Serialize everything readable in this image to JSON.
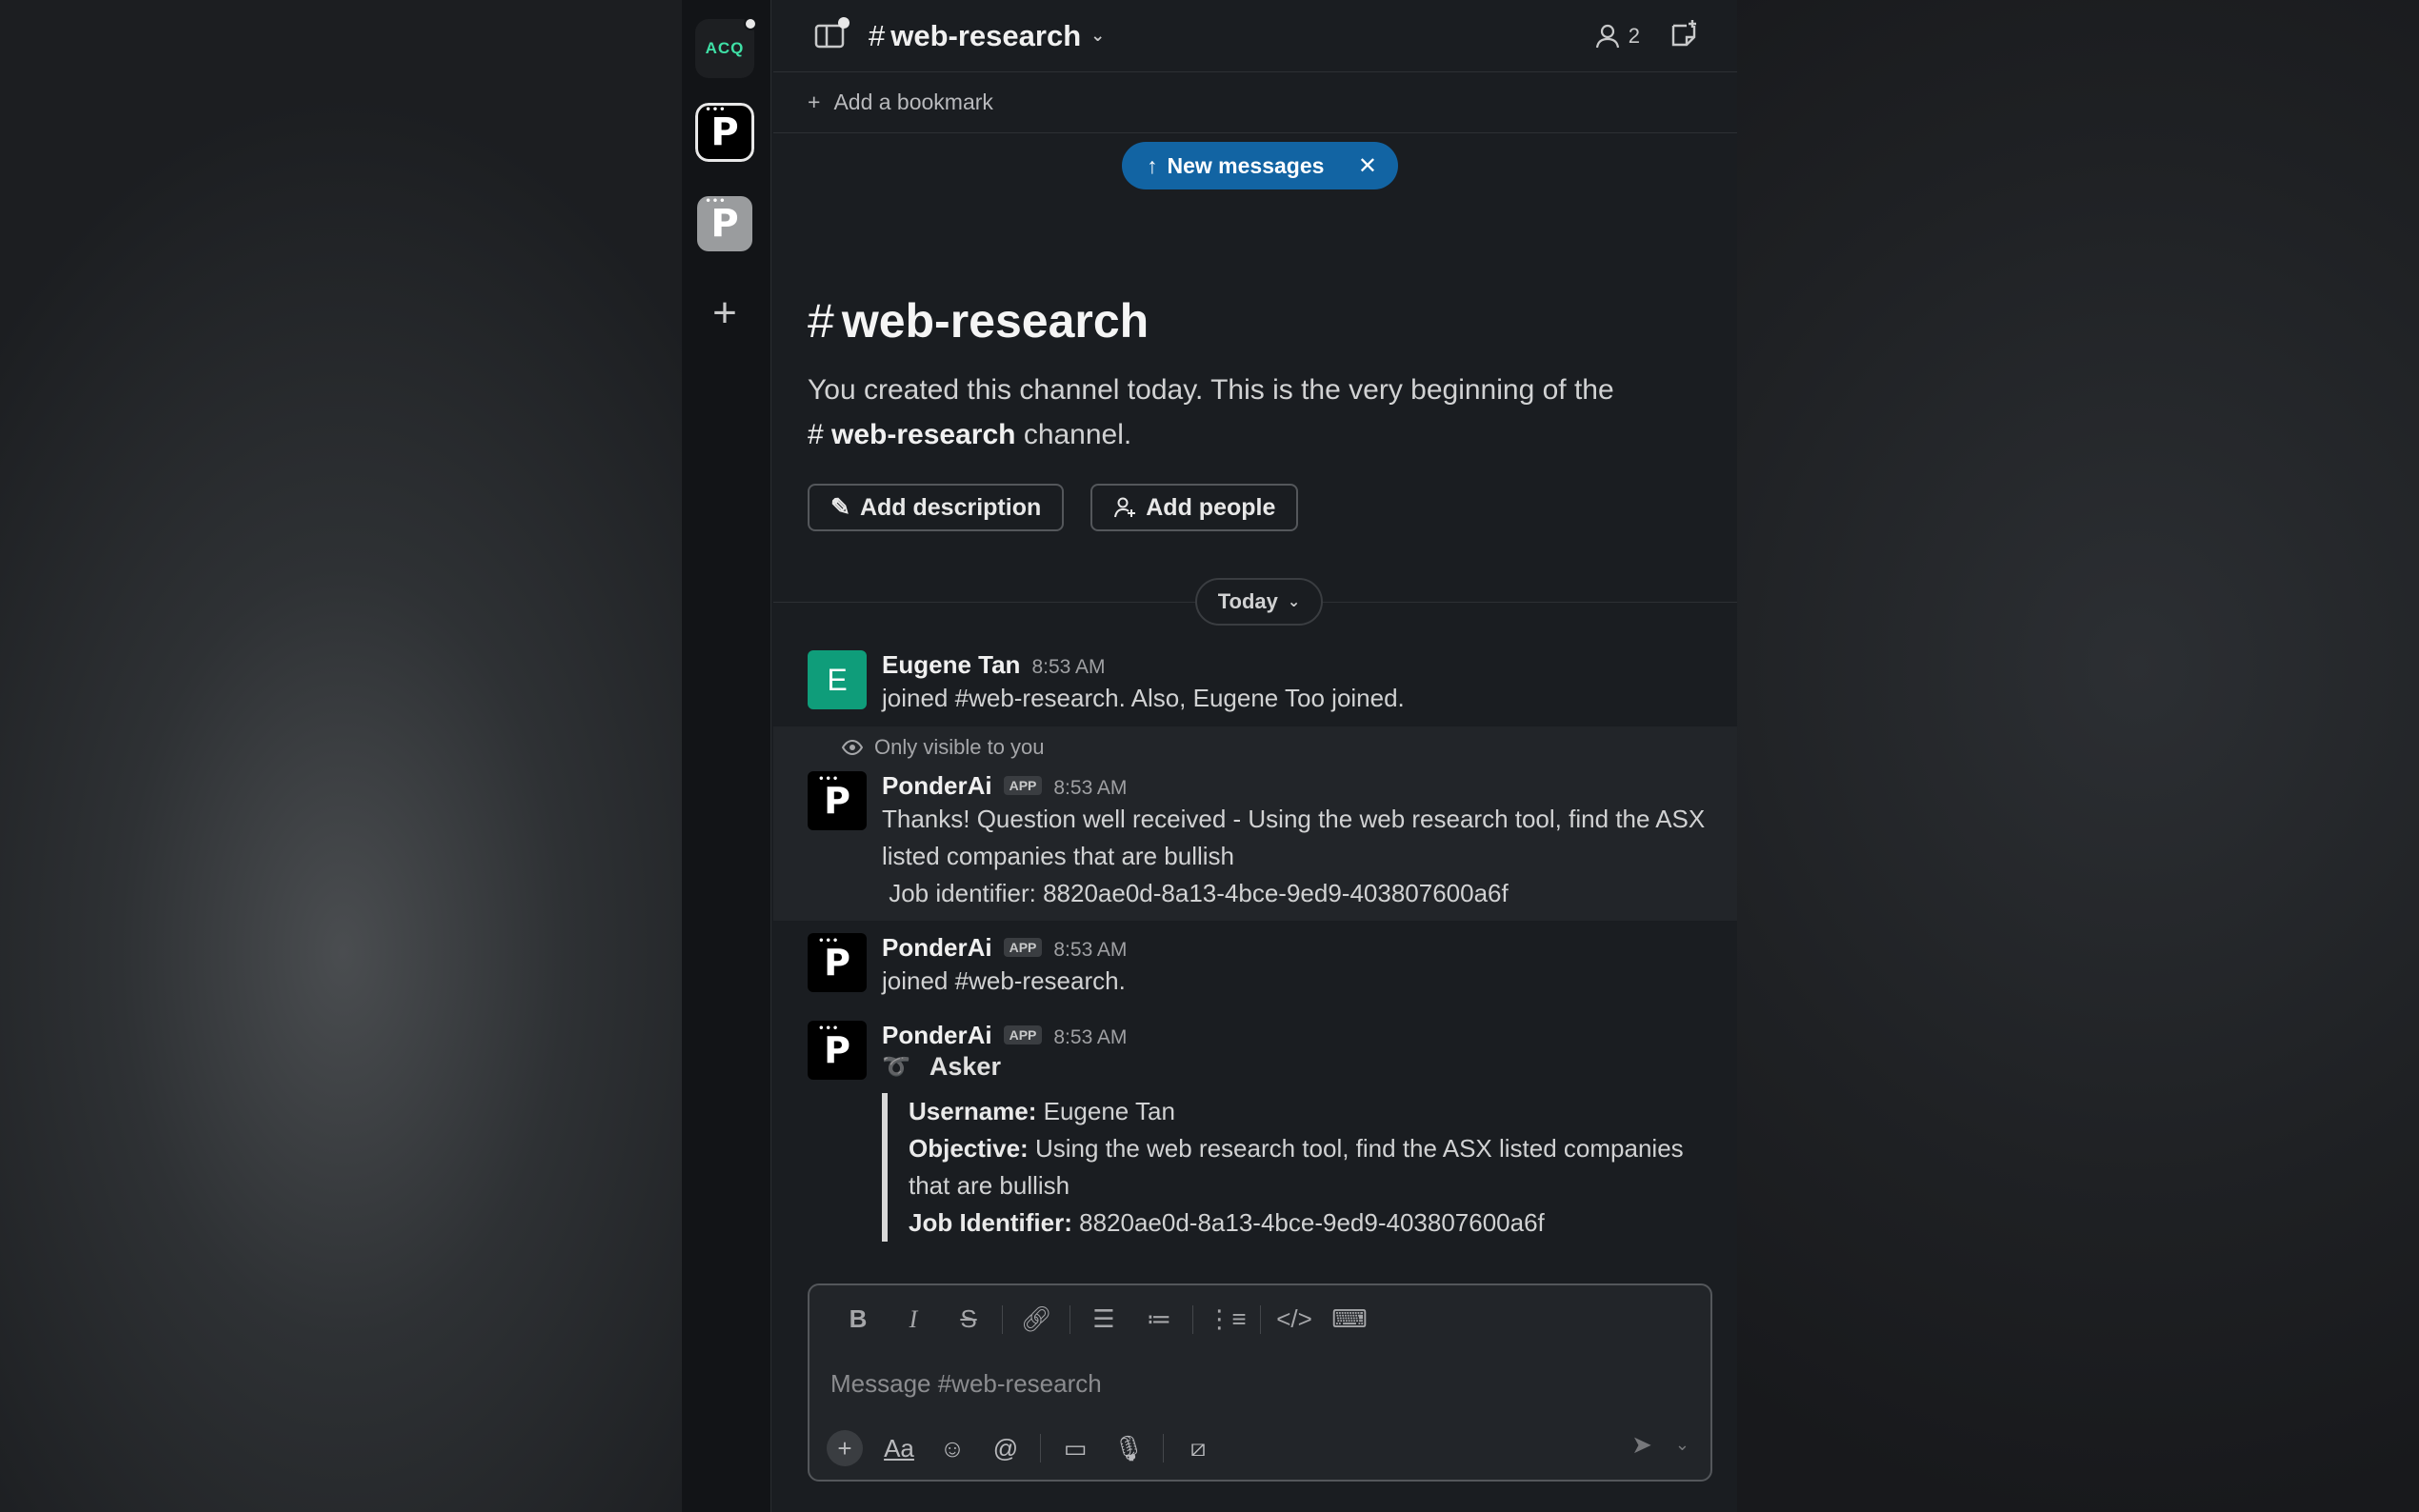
{
  "workspaces": [
    {
      "label": "ACQ"
    },
    {
      "label": "P"
    },
    {
      "label": "P"
    }
  ],
  "header": {
    "channel": "web-research",
    "member_count": "2"
  },
  "bookmarks": {
    "add_label": "Add a bookmark"
  },
  "banner": {
    "label": "New messages"
  },
  "intro": {
    "title": "web-research",
    "line1": "You created this channel today. This is the very beginning of the",
    "channel_ref": "web-research",
    "line_end": "channel.",
    "add_description": "Add description",
    "add_people": "Add people"
  },
  "divider": {
    "label": "Today"
  },
  "messages": [
    {
      "user": "Eugene Tan",
      "time": "8:53 AM",
      "text": "joined #web-research. Also, Eugene Too joined.",
      "initial": "E"
    },
    {
      "visibility": "Only visible to you",
      "user": "PonderAi",
      "badge": "APP",
      "time": "8:53 AM",
      "text": "Thanks! Question well received - Using the web research tool, find the ASX listed companies that are bullish",
      "job_line": " Job identifier: 8820ae0d-8a13-4bce-9ed9-403807600a6f"
    },
    {
      "user": "PonderAi",
      "badge": "APP",
      "time": "8:53 AM",
      "text": "joined #web-research."
    },
    {
      "user": "PonderAi",
      "badge": "APP",
      "time": "8:53 AM",
      "asker_title": "Asker",
      "username_label": "Username:",
      "username": " Eugene Tan",
      "objective_label": "Objective:",
      "objective": " Using the web research tool, find the ASX listed companies that are bullish",
      "job_label": "Job Identifier:",
      "job": " 8820ae0d-8a13-4bce-9ed9-403807600a6f"
    }
  ],
  "composer": {
    "placeholder": "Message #web-research"
  },
  "colors": {
    "accent": "#1264a3",
    "avatar_e": "#0f9d7a",
    "background": "#1a1d21"
  }
}
